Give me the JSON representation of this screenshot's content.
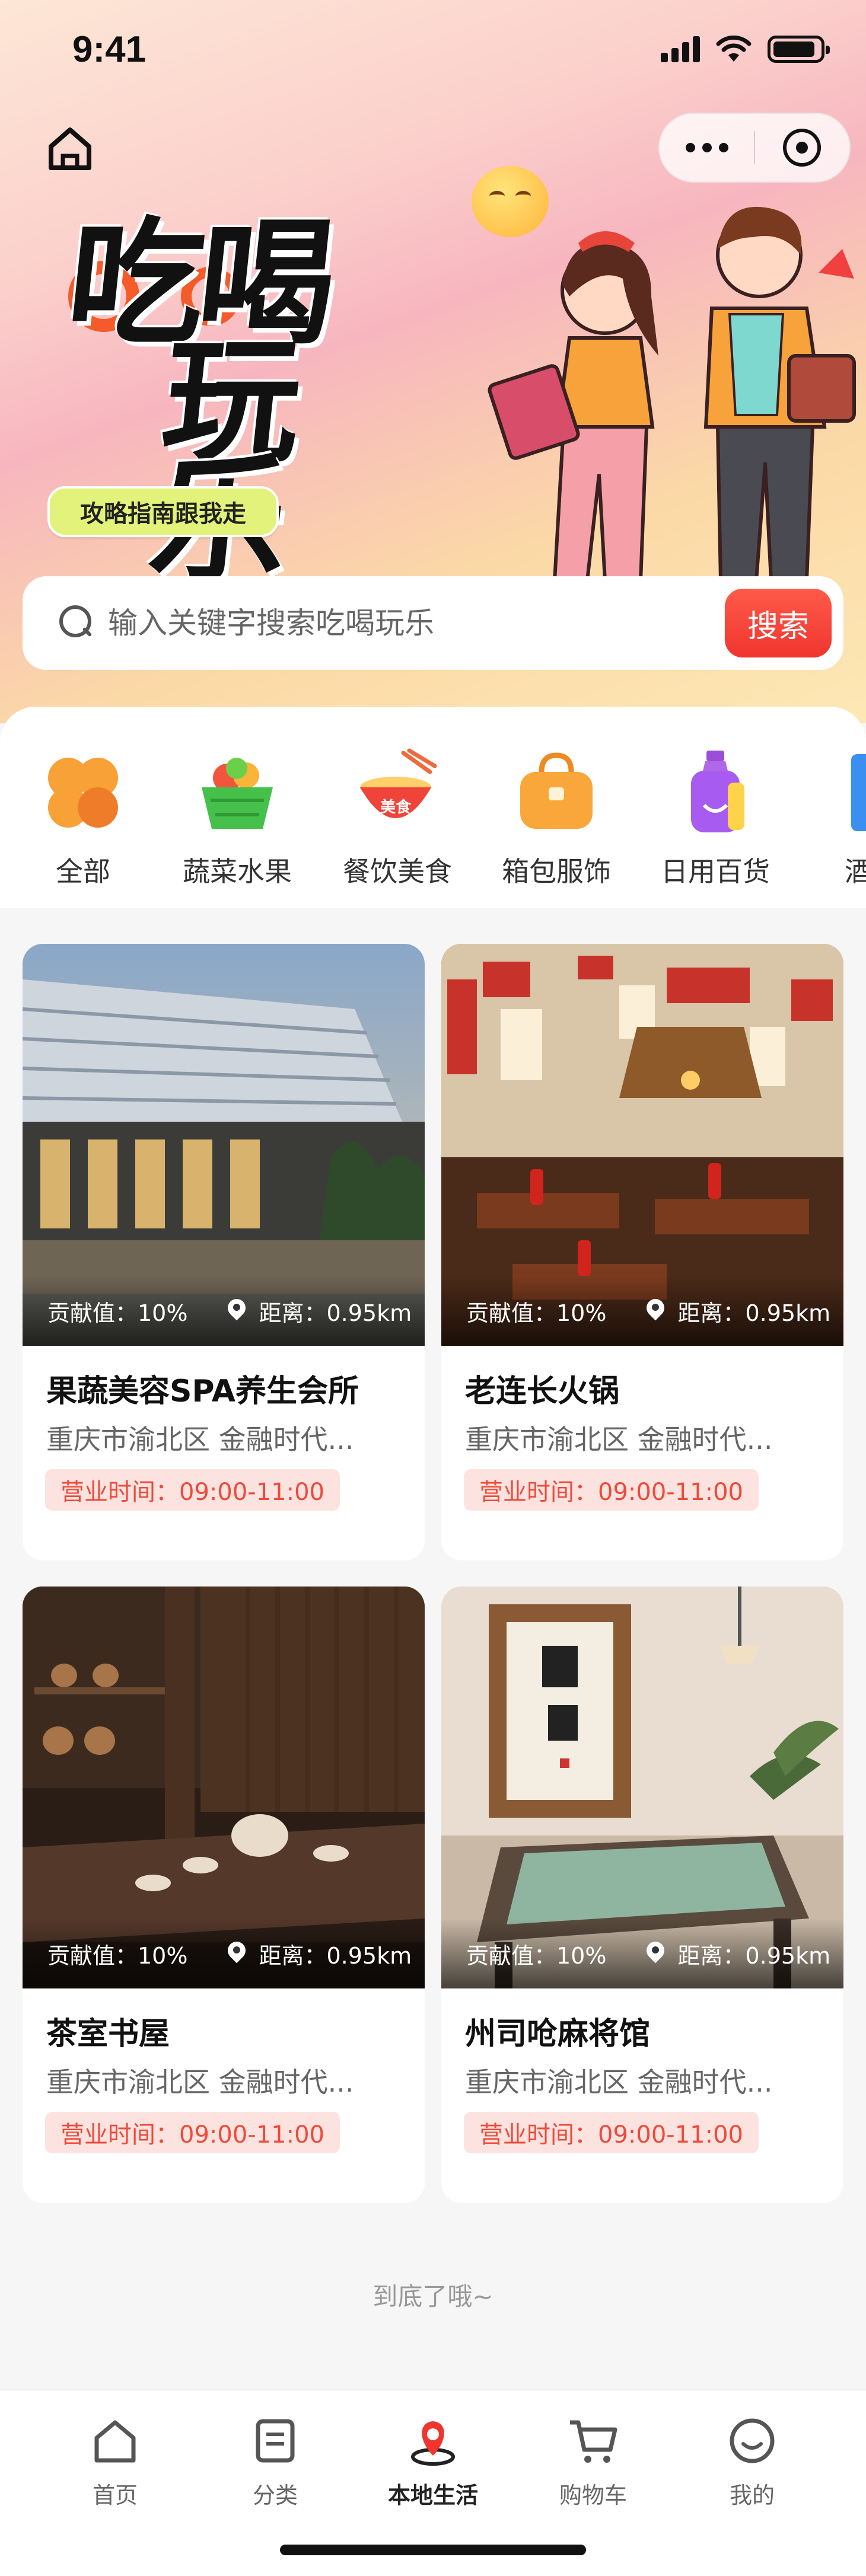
{
  "status_bar": {
    "time": "9:41"
  },
  "hero": {
    "title_line1": "吃喝",
    "title_line2": "玩乐",
    "tagline": "攻略指南跟我走"
  },
  "search": {
    "placeholder": "输入关键字搜索吃喝玩乐",
    "button_label": "搜索"
  },
  "categories": [
    {
      "label": "全部",
      "icon": "clover-icon"
    },
    {
      "label": "蔬菜水果",
      "icon": "fruit-basket-icon"
    },
    {
      "label": "餐饮美食",
      "icon": "food-bowl-icon",
      "badge": "美食"
    },
    {
      "label": "箱包服饰",
      "icon": "bag-icon"
    },
    {
      "label": "日用百货",
      "icon": "bottle-icon"
    },
    {
      "label": "酒店",
      "icon": "hotel-icon"
    }
  ],
  "stores": [
    {
      "name": "果蔬美容SPA养生会所",
      "address": "重庆市渝北区 金融时代...",
      "contribution": "贡献值：10%",
      "distance": "距离：0.95km",
      "hours": "营业时间：09:00-11:00"
    },
    {
      "name": "老连长火锅",
      "address": "重庆市渝北区 金融时代...",
      "contribution": "贡献值：10%",
      "distance": "距离：0.95km",
      "hours": "营业时间：09:00-11:00"
    },
    {
      "name": "茶室书屋",
      "address": "重庆市渝北区 金融时代...",
      "contribution": "贡献值：10%",
      "distance": "距离：0.95km",
      "hours": "营业时间：09:00-11:00"
    },
    {
      "name": "州司呛麻将馆",
      "address": "重庆市渝北区 金融时代...",
      "contribution": "贡献值：10%",
      "distance": "距离：0.95km",
      "hours": "营业时间：09:00-11:00"
    }
  ],
  "end_note": "到底了哦~",
  "tabbar": [
    {
      "label": "首页",
      "icon": "home-icon"
    },
    {
      "label": "分类",
      "icon": "category-icon"
    },
    {
      "label": "本地生活",
      "icon": "location-icon",
      "active": true
    },
    {
      "label": "购物车",
      "icon": "cart-icon"
    },
    {
      "label": "我的",
      "icon": "smile-icon"
    }
  ],
  "colors": {
    "accent": "#f0352e",
    "tag_bg": "#e2f27a",
    "hours_bg": "#fde3e0"
  }
}
